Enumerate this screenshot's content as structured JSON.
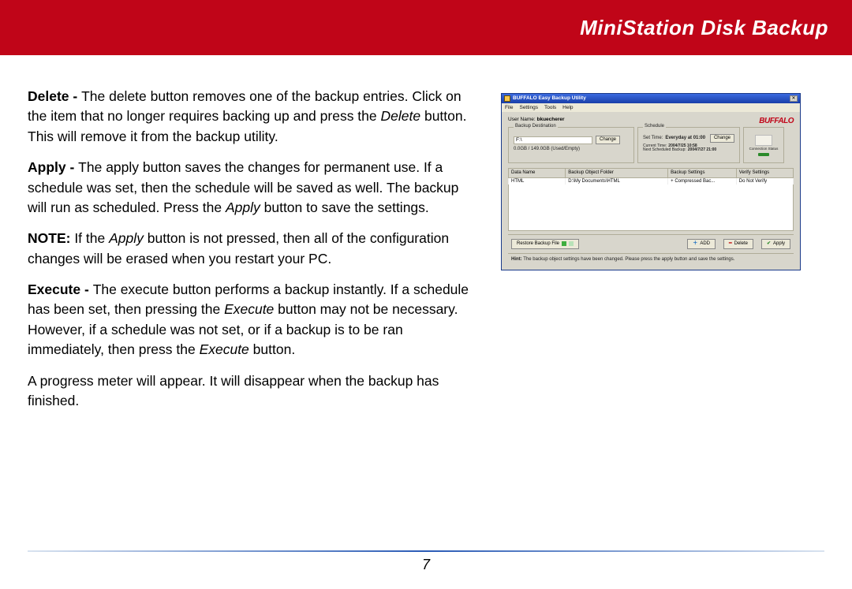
{
  "header": {
    "title": "MiniStation Disk Backup"
  },
  "paragraphs": {
    "delete_label": "Delete - ",
    "delete_body_a": "The delete button removes one of the backup entries.  Click on the item that no longer requires backing up and press the ",
    "delete_italic": "Delete",
    "delete_body_b": " button.  This will remove it from the backup utility.",
    "apply_label": "Apply - ",
    "apply_body_a": "The apply button saves the changes for permanent use.  If a schedule was set, then the schedule will be saved as well.  The backup will run as scheduled.  Press the ",
    "apply_italic": "Apply",
    "apply_body_b": " button to save the settings.",
    "note_label": "NOTE:",
    "note_body_a": "  If the ",
    "note_italic": "Apply",
    "note_body_b": " button is not pressed, then all of the configuration changes will be erased when you restart your PC.",
    "execute_label": "Execute - ",
    "execute_body_a": "The execute button performs a backup instantly.  If a schedule has been set, then pressing the ",
    "execute_italic_1": "Execute",
    "execute_body_b": " button may not be necessary.  However, if a schedule was not set, or if a backup is to be ran immediately, then press the ",
    "execute_italic_2": "Execute",
    "execute_body_c": " button.",
    "progress": "A progress meter will appear.  It will disappear when the backup has finished."
  },
  "app": {
    "title": "BUFFALO Easy Backup Utility",
    "menu": {
      "file": "File",
      "settings": "Settings",
      "tools": "Tools",
      "help": "Help"
    },
    "username_label": "User Name:",
    "username_value": "bkuecherer",
    "logo": "BUFFALO",
    "panel_dest": {
      "label": "Backup Destination",
      "drive": "F:\\",
      "change": "Change",
      "capacity": "0.0GB / 149.0GB  (Used/Empty)"
    },
    "panel_sched": {
      "label": "Schedule",
      "set_time_label": "Set Time:",
      "set_time_value": "Everyday at 01:00",
      "change": "Change",
      "current_label": "Current Time:",
      "current_value": "2004/7/25 10:58",
      "next_label": "Next Scheduled Backup:",
      "next_value": "2004/7/27 21:00"
    },
    "panel_conn": {
      "label": "Connection Status"
    },
    "columns": {
      "c1": "Data Name",
      "c2": "Backup Object Folder",
      "c3": "Backup Settings",
      "c4": "Verify Settings"
    },
    "row1": {
      "c1": "HTML",
      "c2": "D:\\My Documents\\HTML",
      "c3": "+ Compressed Bac...",
      "c4": "Do Not Verify"
    },
    "buttons": {
      "execute": "Restore Backup File",
      "add": "ADD",
      "delete": "Delete",
      "apply": "Apply"
    },
    "hint_label": "Hint:",
    "hint_text": " The backup object settings have been changed. Please press the apply button and save the settings."
  },
  "page_number": "7"
}
